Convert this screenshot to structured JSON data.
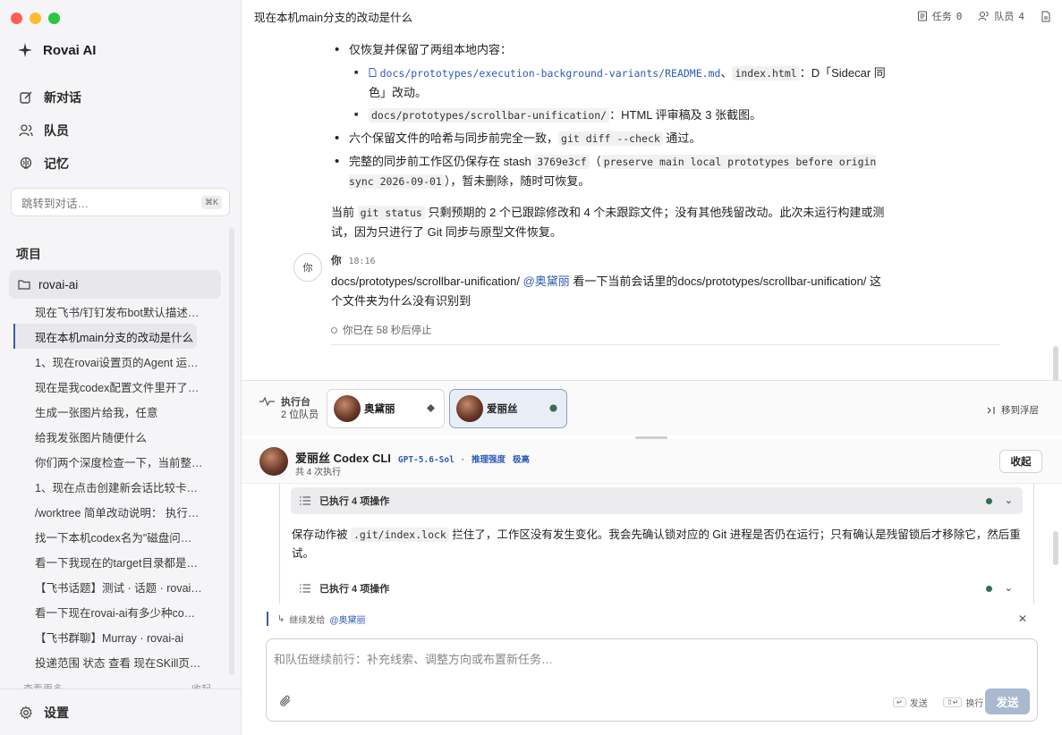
{
  "window": {
    "traffic_colors": [
      "#ff5f57",
      "#febc2e",
      "#28c840"
    ]
  },
  "sidebar": {
    "brand": "Rovai AI",
    "nav": [
      {
        "label": "新对话",
        "icon": "edit-icon"
      },
      {
        "label": "队员",
        "icon": "users-icon"
      },
      {
        "label": "记忆",
        "icon": "brain-icon"
      }
    ],
    "jump_placeholder": "跳转到对话…",
    "jump_shortcut": "⌘K",
    "projects_title": "项目",
    "project_name": "rovai-ai",
    "threads": [
      "现在飞书/钉钉发布bot默认描述…",
      "现在本机main分支的改动是什么",
      "1、现在rovai设置页的Agent 运…",
      "现在是我codex配置文件里开了…",
      "生成一张图片给我，任意",
      "给我发张图片随便什么",
      "你们两个深度检查一下，当前整…",
      "1、现在点击创建新会话比较卡…",
      "/worktree 简单改动说明： 执行…",
      "找一下本机codex名为\"磁盘问…",
      "看一下我现在的target目录都是…",
      "【飞书话题】测试 · 话题 · rovai…",
      "看一下现在rovai-ai有多少种co…",
      "【飞书群聊】Murray · rovai-ai",
      "投递范围 状态 查看 现在SKill页…"
    ],
    "more_left": "查看更多",
    "more_right": "收起",
    "settings": "设置"
  },
  "topbar": {
    "title": "现在本机main分支的改动是什么",
    "tasks_label": "任务",
    "tasks_count": "0",
    "members_label": "队员",
    "members_count": "4"
  },
  "conversation": {
    "b1": "仅恢复并保留了两组本地内容：",
    "b1a_path": "docs/prototypes/execution-background-variants/README.md",
    "b1a_sep": "、",
    "b1a_code": "index.html",
    "b1a_text": "：D「Sidecar 同色」改动。",
    "b1b_code": "docs/prototypes/scrollbar-unification/",
    "b1b_text": "：HTML 评审稿及 3 张截图。",
    "b2_text": "六个保留文件的哈希与同步前完全一致，",
    "b2_code": "git diff --check",
    "b2_tail": " 通过。",
    "b3_text": "完整的同步前工作区仍保存在 stash ",
    "b3_code1": "3769e3cf",
    "b3_mid": "（",
    "b3_code2": "preserve main local prototypes before origin sync 2026-09-01",
    "b3_tail": "），暂未删除，随时可恢复。",
    "p_head": "当前 ",
    "p_code": "git status",
    "p_tail": " 只剩预期的 2 个已跟踪修改和 4 个未跟踪文件；没有其他残留改动。此次未运行构建或测试，因为只进行了 Git 同步与原型文件恢复。",
    "you_avatar": "你",
    "you_name": "你",
    "you_time": "18:16",
    "you_msg_a": "docs/prototypes/scrollbar-unification/ ",
    "you_mention": "@奥黛丽",
    "you_msg_b": " 看一下当前会话里的docs/prototypes/scrollbar-unification/ 这个文件夹为什么没有识别到",
    "stopped": "你已在 58 秒后停止"
  },
  "execbar": {
    "title": "执行台",
    "sub": "2 位队员",
    "agents": [
      {
        "name": "奥黛丽",
        "state": "diamond"
      },
      {
        "name": "爱丽丝",
        "state": "dot"
      }
    ],
    "move_float": "移到浮层",
    "status_color": "#3a6b50"
  },
  "agent_panel": {
    "name": "爱丽丝 Codex CLI",
    "model": "GPT-5.6-Sol",
    "sep": "·",
    "reasoning_label": "推理强度",
    "reasoning_value": "极高",
    "sub": "共 4 次执行",
    "collapse": "收起",
    "row1": "已执行 4 项操作",
    "log_a": "保存动作被 ",
    "log_code": ".git/index.lock",
    "log_b": " 拦住了，工作区没有发生变化。我会先确认锁对应的 Git 进程是否仍在运行；只有确认是残留锁后才移除它，然后重试。",
    "row2": "已执行 4 项操作"
  },
  "composer": {
    "reply_prefix": "继续发给",
    "reply_target": "@奥黛丽",
    "placeholder": "和队伍继续前行：补充线索、调整方向或布置新任务…",
    "send_hint_key": "↵",
    "send_hint": "发送",
    "newline_key": "⇧↵",
    "newline_hint": "换行",
    "send": "发送",
    "accent": "#3a5ba8"
  }
}
